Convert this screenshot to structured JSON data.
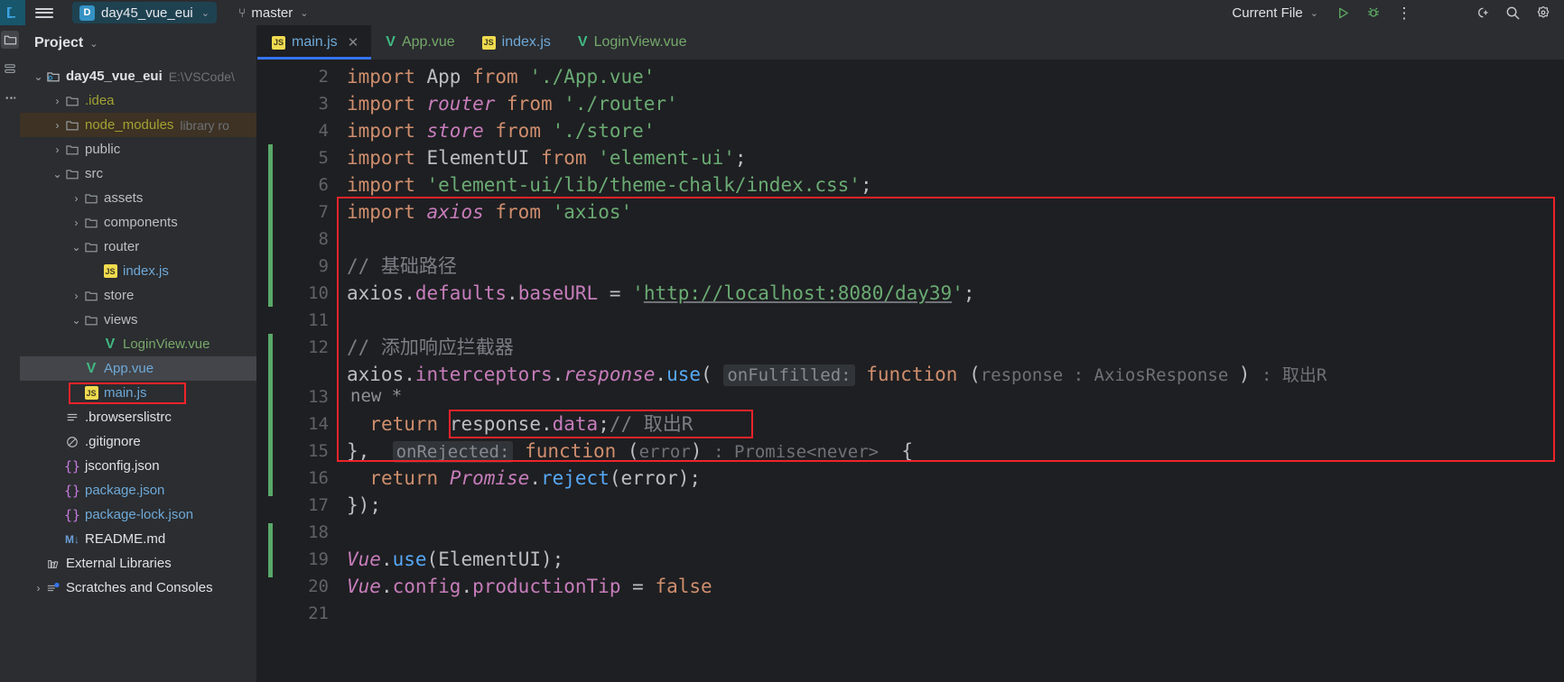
{
  "topbar": {
    "project_badge": "D",
    "project_name": "day45_vue_eui",
    "branch_icon": "branch-icon",
    "branch_name": "master",
    "run_config": "Current File",
    "icons": {
      "hamburger": "hamburger-icon",
      "run": "run-icon",
      "debug": "debug-icon",
      "more": "more-options-icon",
      "code_with_me": "code-with-me-icon",
      "search": "search-icon",
      "settings": "settings-icon"
    }
  },
  "toolstrip": {
    "buttons": [
      {
        "name": "project-tool-button",
        "glyph": "folder"
      },
      {
        "name": "commit-tool-button",
        "glyph": "commit"
      },
      {
        "name": "structure-tool-button",
        "glyph": "structure"
      }
    ]
  },
  "project_panel": {
    "title": "Project",
    "chevron": "chevron-down-icon",
    "tree": [
      {
        "indent": 0,
        "arrow": "v",
        "icon": "module",
        "label": "day45_vue_eui",
        "sub": "E:\\VSCode\\",
        "style": "root",
        "state": "normal"
      },
      {
        "indent": 1,
        "arrow": ">",
        "icon": "folder",
        "label": ".idea",
        "sub": "",
        "style": "olive",
        "state": "normal"
      },
      {
        "indent": 1,
        "arrow": ">",
        "icon": "folder",
        "label": "node_modules",
        "sub": "library ro",
        "style": "olive",
        "state": "highlight"
      },
      {
        "indent": 1,
        "arrow": ">",
        "icon": "folder",
        "label": "public",
        "sub": "",
        "style": "grey",
        "state": "normal"
      },
      {
        "indent": 1,
        "arrow": "v",
        "icon": "folder",
        "label": "src",
        "sub": "",
        "style": "grey",
        "state": "normal"
      },
      {
        "indent": 2,
        "arrow": ">",
        "icon": "folder",
        "label": "assets",
        "sub": "",
        "style": "grey",
        "state": "normal"
      },
      {
        "indent": 2,
        "arrow": ">",
        "icon": "folder",
        "label": "components",
        "sub": "",
        "style": "grey",
        "state": "normal"
      },
      {
        "indent": 2,
        "arrow": "v",
        "icon": "folder",
        "label": "router",
        "sub": "",
        "style": "grey",
        "state": "normal"
      },
      {
        "indent": 3,
        "arrow": "",
        "icon": "js",
        "label": "index.js",
        "sub": "",
        "style": "blue",
        "state": "normal"
      },
      {
        "indent": 2,
        "arrow": ">",
        "icon": "folder",
        "label": "store",
        "sub": "",
        "style": "grey",
        "state": "normal"
      },
      {
        "indent": 2,
        "arrow": "v",
        "icon": "folder",
        "label": "views",
        "sub": "",
        "style": "grey",
        "state": "normal"
      },
      {
        "indent": 3,
        "arrow": "",
        "icon": "vue",
        "label": "LoginView.vue",
        "sub": "",
        "style": "green",
        "state": "normal"
      },
      {
        "indent": 2,
        "arrow": "",
        "icon": "vue",
        "label": "App.vue",
        "sub": "",
        "style": "blue",
        "state": "selected"
      },
      {
        "indent": 2,
        "arrow": "",
        "icon": "js",
        "label": "main.js",
        "sub": "",
        "style": "blue",
        "state": "boxed"
      },
      {
        "indent": 1,
        "arrow": "",
        "icon": "text",
        "label": ".browserslistrc",
        "sub": "",
        "style": "white",
        "state": "normal"
      },
      {
        "indent": 1,
        "arrow": "",
        "icon": "ignore",
        "label": ".gitignore",
        "sub": "",
        "style": "white",
        "state": "normal"
      },
      {
        "indent": 1,
        "arrow": "",
        "icon": "json",
        "label": "jsconfig.json",
        "sub": "",
        "style": "white",
        "state": "normal"
      },
      {
        "indent": 1,
        "arrow": "",
        "icon": "json",
        "label": "package.json",
        "sub": "",
        "style": "blue",
        "state": "normal"
      },
      {
        "indent": 1,
        "arrow": "",
        "icon": "json",
        "label": "package-lock.json",
        "sub": "",
        "style": "blue",
        "state": "normal"
      },
      {
        "indent": 1,
        "arrow": "",
        "icon": "md",
        "label": "README.md",
        "sub": "",
        "style": "white",
        "state": "normal"
      },
      {
        "indent": 0,
        "arrow": "",
        "icon": "library",
        "label": "External Libraries",
        "sub": "",
        "style": "white",
        "state": "normal"
      },
      {
        "indent": 0,
        "arrow": ">",
        "icon": "scratch",
        "label": "Scratches and Consoles",
        "sub": "",
        "style": "white",
        "state": "normal"
      }
    ]
  },
  "tabs": [
    {
      "icon": "js",
      "label": "main.js",
      "active": true,
      "closable": true
    },
    {
      "icon": "vue",
      "label": "App.vue",
      "active": false,
      "closable": false
    },
    {
      "icon": "js",
      "label": "index.js",
      "active": false,
      "closable": false
    },
    {
      "icon": "vue",
      "label": "LoginView.vue",
      "active": false,
      "closable": false
    }
  ],
  "editor": {
    "file": "main.js",
    "first_visible_line": 2,
    "last_visible_line": 21,
    "lines": [
      {
        "n": 2,
        "vcs": false,
        "text": "import App from './App.vue'"
      },
      {
        "n": 3,
        "vcs": false,
        "text": "import router from './router'"
      },
      {
        "n": 4,
        "vcs": false,
        "text": "import store from './store'"
      },
      {
        "n": 5,
        "vcs": true,
        "text": "import ElementUI from 'element-ui';"
      },
      {
        "n": 6,
        "vcs": true,
        "text": "import 'element-ui/lib/theme-chalk/index.css';"
      },
      {
        "n": 7,
        "vcs": true,
        "text": "import axios from 'axios'"
      },
      {
        "n": 8,
        "vcs": true,
        "text": ""
      },
      {
        "n": 9,
        "vcs": true,
        "text": "// 基础路径"
      },
      {
        "n": 10,
        "vcs": true,
        "text": "axios.defaults.baseURL = 'http://localhost:8080/day39';"
      },
      {
        "n": 11,
        "vcs": false,
        "text": ""
      },
      {
        "n": 12,
        "vcs": true,
        "text": "// 添加响应拦截器"
      },
      {
        "n": 13,
        "vcs": true,
        "text": "axios.interceptors.response.use( onFulfilled: function (response : AxiosResponse ) : 取出R"
      },
      {
        "n": 14,
        "vcs": true,
        "text": "  return response.data;// 取出R"
      },
      {
        "n": 15,
        "vcs": true,
        "text": "}, onRejected: function (error) : Promise<never>  {"
      },
      {
        "n": 16,
        "vcs": true,
        "text": "  return Promise.reject(error);"
      },
      {
        "n": 17,
        "vcs": true,
        "text": "});"
      },
      {
        "n": 18,
        "vcs": false,
        "text": ""
      },
      {
        "n": 19,
        "vcs": true,
        "text": "Vue.use(ElementUI);"
      },
      {
        "n": 20,
        "vcs": true,
        "text": "Vue.config.productionTip = false"
      },
      {
        "n": 21,
        "vcs": false,
        "text": ""
      }
    ],
    "inlay_hints": [
      "onFulfilled:",
      "onRejected:"
    ],
    "code_vision": "new *",
    "url": "http://localhost:8080/day39",
    "annotations": [
      {
        "name": "red-box-code-block",
        "desc": "red rectangle around lines 7-17"
      },
      {
        "name": "red-box-return-data",
        "desc": "red rectangle around response.data;// 取出R"
      },
      {
        "name": "red-box-main-js",
        "desc": "red rectangle around main.js in project tree"
      }
    ]
  },
  "colors": {
    "accent": "#3574f0",
    "annotation_red": "#f0232a",
    "vcs_green": "#59a869",
    "editor_bg": "#1e1f22",
    "panel_bg": "#2b2d30"
  }
}
